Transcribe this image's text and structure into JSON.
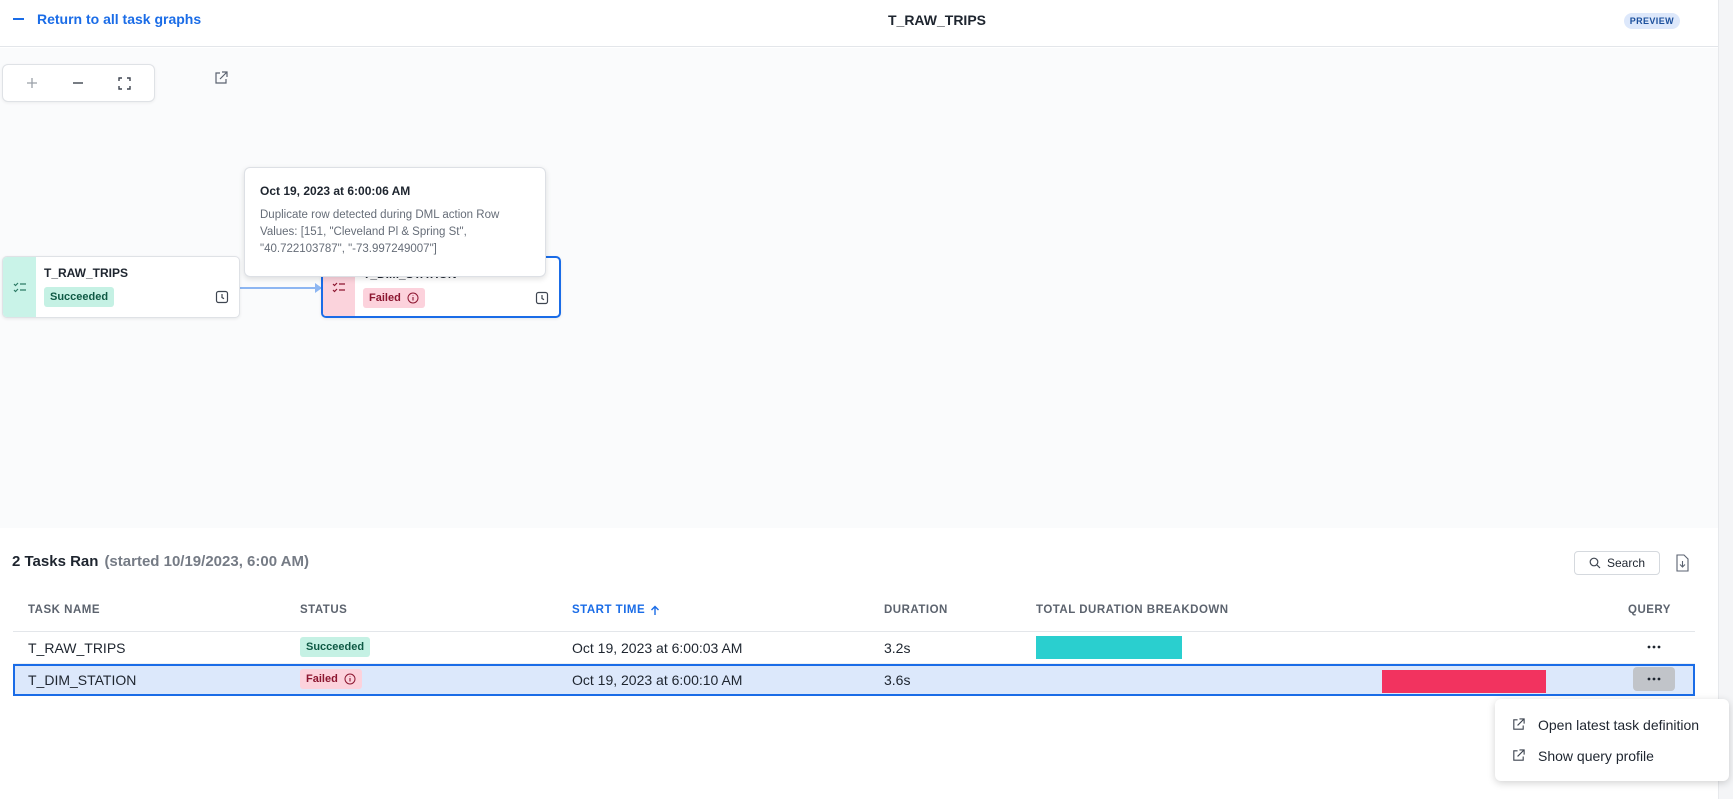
{
  "header": {
    "back_label": "Return to all task graphs",
    "title": "T_RAW_TRIPS",
    "preview_badge": "PREVIEW"
  },
  "graph": {
    "nodes": [
      {
        "name": "T_RAW_TRIPS",
        "status": "Succeeded"
      },
      {
        "name": "T_DIM_STATION",
        "status": "Failed"
      }
    ],
    "tooltip": {
      "title": "Oct 19, 2023 at 6:00:06 AM",
      "body": "Duplicate row detected during DML action Row Values: [151, \"Cleveland Pl & Spring St\", \"40.722103787\", \"-73.997249007\"]"
    }
  },
  "tasks": {
    "title": "2 Tasks Ran",
    "subtitle": "(started 10/19/2023, 6:00 AM)",
    "search_label": "Search",
    "columns": [
      "TASK NAME",
      "STATUS",
      "START TIME",
      "DURATION",
      "TOTAL DURATION BREAKDOWN",
      "QUERY"
    ],
    "rows": [
      {
        "name": "T_RAW_TRIPS",
        "status": "Succeeded",
        "start": "Oct 19, 2023 at 6:00:03 AM",
        "duration": "3.2s",
        "breakdown": {
          "start": 0.0,
          "end": 0.47,
          "color": "#2acfcf"
        }
      },
      {
        "name": "T_DIM_STATION",
        "status": "Failed",
        "start": "Oct 19, 2023 at 6:00:10 AM",
        "duration": "3.6s",
        "breakdown": {
          "start": 1.11,
          "end": 1.64,
          "color": "#f2335f"
        }
      }
    ]
  },
  "menu": {
    "items": [
      "Open latest task definition",
      "Show query profile"
    ]
  }
}
